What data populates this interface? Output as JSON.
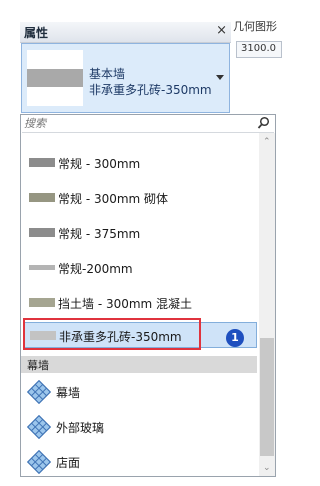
{
  "background_window": {
    "title_fragment": "几何图形",
    "field_value": "3100.0"
  },
  "properties_panel": {
    "title": "属性",
    "close_glyph": "×",
    "type_selector": {
      "family": "基本墙",
      "type": "非承重多孔砖-350mm"
    }
  },
  "dropdown": {
    "search_placeholder": "搜索",
    "items": [
      {
        "label": "常规 - 300mm",
        "swatch_color": "#8c8c8c"
      },
      {
        "label": "常规 - 300mm 砌体",
        "swatch_color": "#969682"
      },
      {
        "label": "常规 - 375mm",
        "swatch_color": "#8c8c8c"
      },
      {
        "label": "常规-200mm",
        "swatch_color": "#b4b4b4"
      },
      {
        "label": "挡土墙 - 300mm 混凝土",
        "swatch_color": "#a5a591"
      }
    ],
    "selected_item": {
      "label": "非承重多孔砖-350mm",
      "swatch_color": "#c3c3c3"
    },
    "callout_number": "1",
    "group_curtain": {
      "header": "幕墙",
      "items": [
        {
          "label": "幕墙",
          "icon": "curtain-grid-icon"
        },
        {
          "label": "外部玻璃",
          "icon": "curtain-grid-icon"
        },
        {
          "label": "店面",
          "icon": "curtain-grid-icon"
        }
      ]
    }
  },
  "colors": {
    "selection_fill": "#cfe3f8",
    "annotation_red": "#e0333d",
    "callout_blue": "#1e4fbf"
  }
}
